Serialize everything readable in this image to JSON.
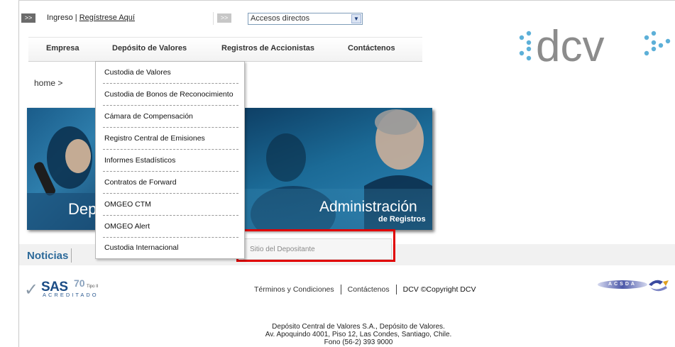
{
  "top_bar": {
    "arrow_symbol": ">>",
    "login_label": "Ingreso",
    "separator": "|",
    "register_label": "Regístrese Aquí",
    "quick_access_value": "Accesos directos"
  },
  "nav": {
    "items": [
      {
        "label": "Empresa"
      },
      {
        "label": "Depósito de Valores"
      },
      {
        "label": "Registros de Accionistas"
      },
      {
        "label": "Contáctenos"
      }
    ]
  },
  "dropdown": {
    "items": [
      {
        "label": "Custodia de Valores"
      },
      {
        "label": "Custodia de Bonos de Reconocimiento"
      },
      {
        "label": "Cámara de Compensación"
      },
      {
        "label": "Registro Central de Emisiones"
      },
      {
        "label": "Informes Estadísticos"
      },
      {
        "label": "Contratos de Forward"
      },
      {
        "label": "OMGEO CTM"
      },
      {
        "label": "OMGEO Alert"
      },
      {
        "label": "Custodia Internacional"
      }
    ]
  },
  "breadcrumb": "home >",
  "banner_left": {
    "text": "Dep"
  },
  "banner_right": {
    "title": "Administración",
    "subtitle": "de Registros"
  },
  "noticias": {
    "title": "Noticias"
  },
  "sitio_depositante": "Sitio del Depositante",
  "footer": {
    "terms": "Términos y Condiciones",
    "contact": "Contáctenos",
    "copyright": "DCV ©Copyright DCV",
    "address_line1": "Depósito Central de Valores S.A., Depósito de Valores.",
    "address_line2": "Av. Apoquindo 4001, Piso 12, Las Condes, Santiago, Chile.",
    "address_line3": "Fono (56-2) 393 9000"
  },
  "badges": {
    "sas_main": "SAS",
    "sas_number": "70",
    "sas_tipo": "Tipo II",
    "sas_acred": "ACREDITADO",
    "acsda": "ACSDA"
  },
  "logo": {
    "text": "dcv"
  },
  "colors": {
    "brand_blue": "#2d6a9a",
    "highlight_red": "#e00000",
    "logo_gray": "#8c8c8c",
    "logo_dots": "#5db0d8"
  }
}
